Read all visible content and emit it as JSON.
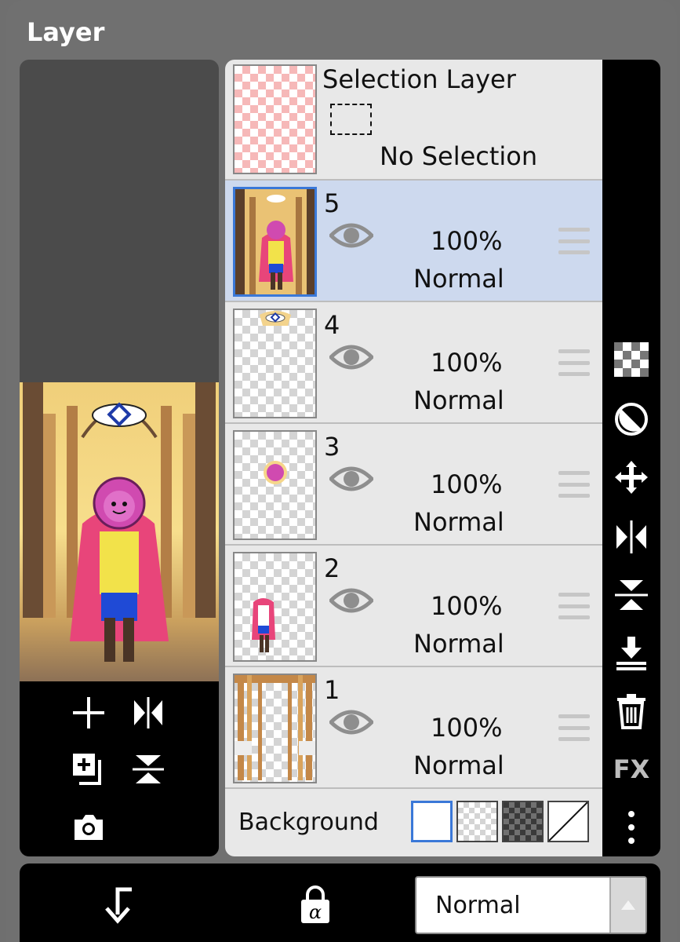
{
  "panel": {
    "title": "Layer"
  },
  "selection_layer": {
    "title": "Selection Layer",
    "state": "No Selection"
  },
  "layers": [
    {
      "number": "5",
      "opacity": "100%",
      "blend": "Normal",
      "selected": true
    },
    {
      "number": "4",
      "opacity": "100%",
      "blend": "Normal",
      "selected": false
    },
    {
      "number": "3",
      "opacity": "100%",
      "blend": "Normal",
      "selected": false
    },
    {
      "number": "2",
      "opacity": "100%",
      "blend": "Normal",
      "selected": false
    },
    {
      "number": "1",
      "opacity": "100%",
      "blend": "Normal",
      "selected": false
    }
  ],
  "background": {
    "label": "Background",
    "options": [
      "white",
      "transparent-light",
      "transparent-dark",
      "none"
    ],
    "selected": "white"
  },
  "right_toolbar": {
    "tools": [
      "transparency-icon",
      "contrast-icon",
      "move-icon",
      "flip-horizontal-icon",
      "flip-vertical-icon",
      "merge-down-icon",
      "trash-icon",
      "fx-icon",
      "more-vertical-icon"
    ],
    "fx_label": "FX"
  },
  "preview_toolbar": {
    "tools": [
      "add-icon",
      "flip-horizontal-icon",
      "duplicate-icon",
      "flip-vertical-icon",
      "camera-icon"
    ]
  },
  "bottom_bar": {
    "blend_mode": "Normal",
    "tools": [
      "clipping-icon",
      "alpha-lock-icon"
    ]
  },
  "colors": {
    "panel": "#707070",
    "selected_row": "#cdd9ee",
    "selected_border": "#3a78d8",
    "toolbar": "#000000"
  }
}
